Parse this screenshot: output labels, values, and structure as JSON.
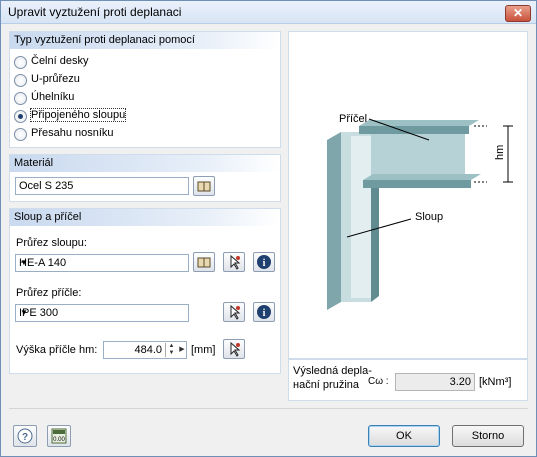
{
  "window": {
    "title": "Upravit vyztužení proti deplanaci",
    "close": "✕"
  },
  "type_group": {
    "header": "Typ vyztužení proti deplanaci pomocí",
    "options": [
      {
        "label": "Čelní desky",
        "checked": false
      },
      {
        "label": "U-průřezu",
        "checked": false
      },
      {
        "label": "Úhelníku",
        "checked": false
      },
      {
        "label": "Připojeného sloupu",
        "checked": true
      },
      {
        "label": "Přesahu nosníku",
        "checked": false
      }
    ]
  },
  "material_group": {
    "header": "Materiál",
    "value": "Ocel S 235"
  },
  "column_group": {
    "header": "Sloup a příčel",
    "column_label": "Průřez sloupu:",
    "column_value": "HE-A 140",
    "beam_label": "Průřez příčle:",
    "beam_value": "IPE 300",
    "height_label": "Výška příčle hm:",
    "height_value": "484.0",
    "height_unit": "[mm]"
  },
  "diagram": {
    "beam_label": "Příčel",
    "column_label": "Sloup",
    "dim_label": "hm"
  },
  "result": {
    "label_line1": "Výsledná depla-",
    "label_line2": "нační pružina",
    "symbol": "Cω :",
    "value": "3.20",
    "unit": "[kNm³]"
  },
  "footer": {
    "ok": "OK",
    "cancel": "Storno"
  },
  "colors": {
    "accent": "#c9d9ef",
    "info": "#1f3f6e"
  }
}
